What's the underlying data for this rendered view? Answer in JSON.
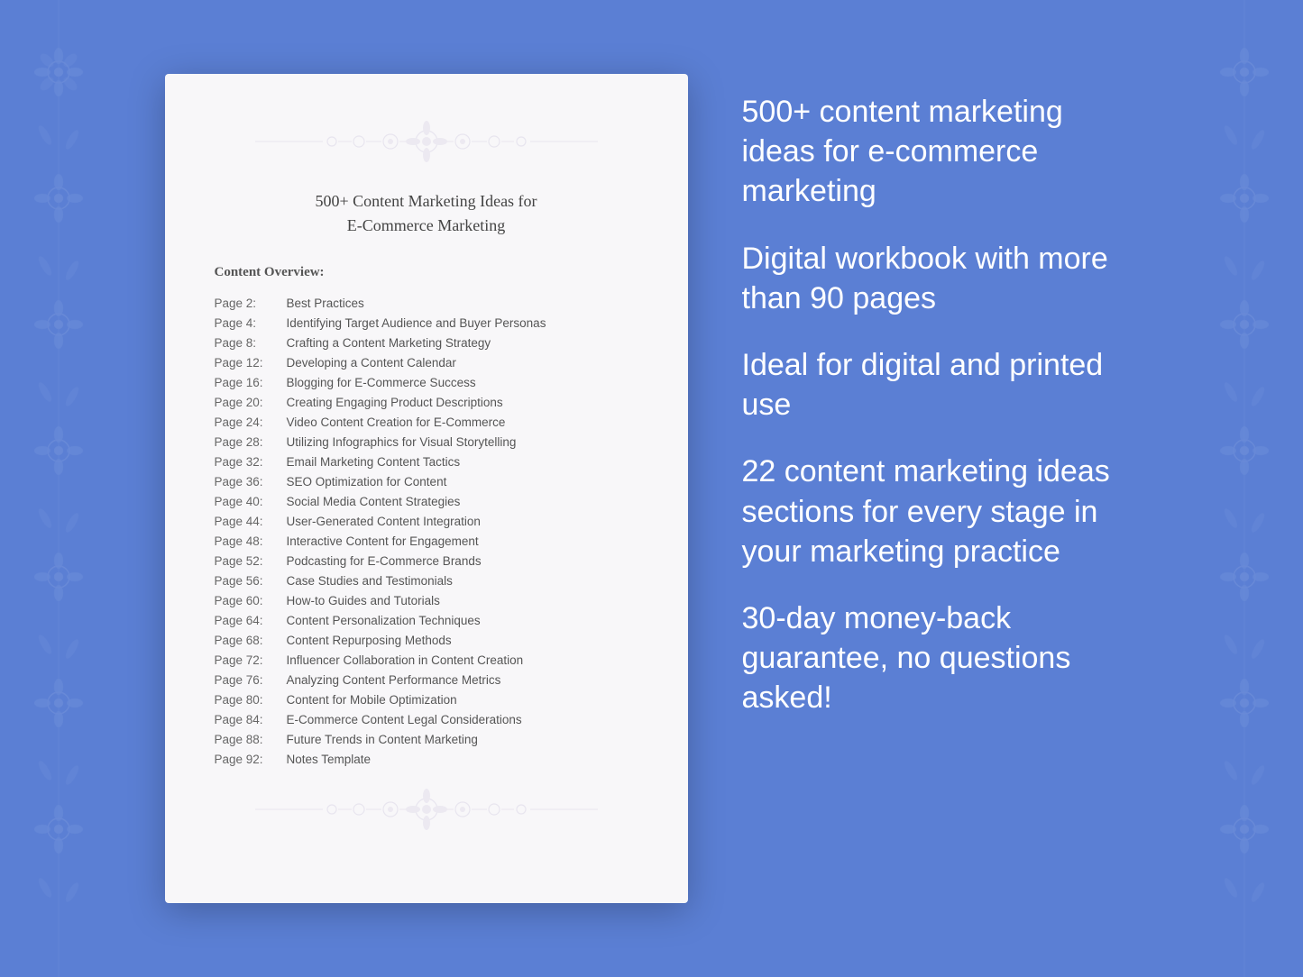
{
  "document": {
    "title_line1": "500+ Content Marketing Ideas for",
    "title_line2": "E-Commerce Marketing",
    "overview_label": "Content Overview:",
    "toc": [
      {
        "page": "Page  2:",
        "title": "Best Practices"
      },
      {
        "page": "Page  4:",
        "title": "Identifying Target Audience and Buyer Personas"
      },
      {
        "page": "Page  8:",
        "title": "Crafting a Content Marketing Strategy"
      },
      {
        "page": "Page 12:",
        "title": "Developing a Content Calendar"
      },
      {
        "page": "Page 16:",
        "title": "Blogging for E-Commerce Success"
      },
      {
        "page": "Page 20:",
        "title": "Creating Engaging Product Descriptions"
      },
      {
        "page": "Page 24:",
        "title": "Video Content Creation for E-Commerce"
      },
      {
        "page": "Page 28:",
        "title": "Utilizing Infographics for Visual Storytelling"
      },
      {
        "page": "Page 32:",
        "title": "Email Marketing Content Tactics"
      },
      {
        "page": "Page 36:",
        "title": "SEO Optimization for Content"
      },
      {
        "page": "Page 40:",
        "title": "Social Media Content Strategies"
      },
      {
        "page": "Page 44:",
        "title": "User-Generated Content Integration"
      },
      {
        "page": "Page 48:",
        "title": "Interactive Content for Engagement"
      },
      {
        "page": "Page 52:",
        "title": "Podcasting for E-Commerce Brands"
      },
      {
        "page": "Page 56:",
        "title": "Case Studies and Testimonials"
      },
      {
        "page": "Page 60:",
        "title": "How-to Guides and Tutorials"
      },
      {
        "page": "Page 64:",
        "title": "Content Personalization Techniques"
      },
      {
        "page": "Page 68:",
        "title": "Content Repurposing Methods"
      },
      {
        "page": "Page 72:",
        "title": "Influencer Collaboration in Content Creation"
      },
      {
        "page": "Page 76:",
        "title": "Analyzing Content Performance Metrics"
      },
      {
        "page": "Page 80:",
        "title": "Content for Mobile Optimization"
      },
      {
        "page": "Page 84:",
        "title": "E-Commerce Content Legal Considerations"
      },
      {
        "page": "Page 88:",
        "title": "Future Trends in Content Marketing"
      },
      {
        "page": "Page 92:",
        "title": "Notes Template"
      }
    ]
  },
  "info_items": [
    "500+ content marketing ideas for e-commerce marketing",
    "Digital workbook with more than 90 pages",
    "Ideal for digital and printed use",
    "22 content marketing ideas sections for every stage in your marketing practice",
    "30-day money-back guarantee, no questions asked!"
  ],
  "background_color": "#5b7fd4"
}
